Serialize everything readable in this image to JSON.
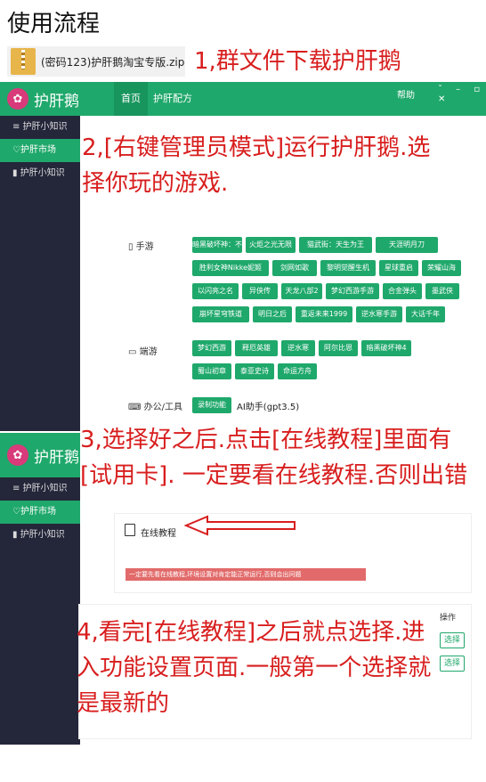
{
  "page_title": "使用流程",
  "zip_file": "(密码123)护肝鹅淘宝专版.zip",
  "steps": {
    "s1": "1,群文件下载护肝鹅",
    "s2": "2,[右键管理员模式]运行护肝鹅.选择你玩的游戏.",
    "s3": "3,选择好之后.点击[在线教程]里面有[试用卡]. 一定要看在线教程.否则出错",
    "s4": "4,看完[在线教程]之后就点选择.进入功能设置页面.一般第一个选择就是最新的"
  },
  "app": {
    "name": "护肝鹅",
    "logo_glyph": "✿",
    "tabs": [
      "首页",
      "护肝配方"
    ],
    "help": "帮助",
    "window_controls": "ˇ – ▫ ✕",
    "sidebar": [
      {
        "label": "≡ 护肝小知识",
        "icon": "menu-icon"
      },
      {
        "label": "♡护肝市场",
        "icon": "heart-icon"
      },
      {
        "label": "▮ 护肝小知识",
        "icon": "bookmark-icon"
      }
    ]
  },
  "categories": {
    "mobile": "▯ 手游",
    "pc": "▭ 端游",
    "office": "⌨ 办公/工具"
  },
  "mobile_games": [
    "暗黑破坏神：不朽",
    "火炬之光无限",
    "猫武街：天生为王",
    "天涯明月刀",
    "胜利女神Nikke妮姬",
    "剑网如歌",
    "黎明觉醒生机",
    "星球重启",
    "荣耀山海",
    "以闪亮之名",
    "异侠传",
    "天龙八部2",
    "梦幻西游手游",
    "合金弹头",
    "墨武侠",
    "崩坏星穹铁道",
    "明日之后",
    "重返未来1999",
    "逆水寒手游",
    "大话千年"
  ],
  "pc_games": [
    "梦幻西游",
    "释厄英雄",
    "逆水寒",
    "阿尔比恩",
    "暗黑破坏神4",
    "蜀山初章",
    "泰亚史诗",
    "命运方舟"
  ],
  "office_tools": {
    "button": "录制功能",
    "label": "AI助手(gpt3.5)"
  },
  "tutorial": {
    "link": "在线教程",
    "warning": "一定要先看在线教程,环境设置对肯定能正常运行,否则会出问题"
  },
  "table": {
    "op_header": "操作",
    "select_label": "选择"
  },
  "colors": {
    "green": "#1fa86b",
    "sidebar": "#24263a",
    "red_text": "#d81e1e",
    "warning": "#e26a6a"
  }
}
